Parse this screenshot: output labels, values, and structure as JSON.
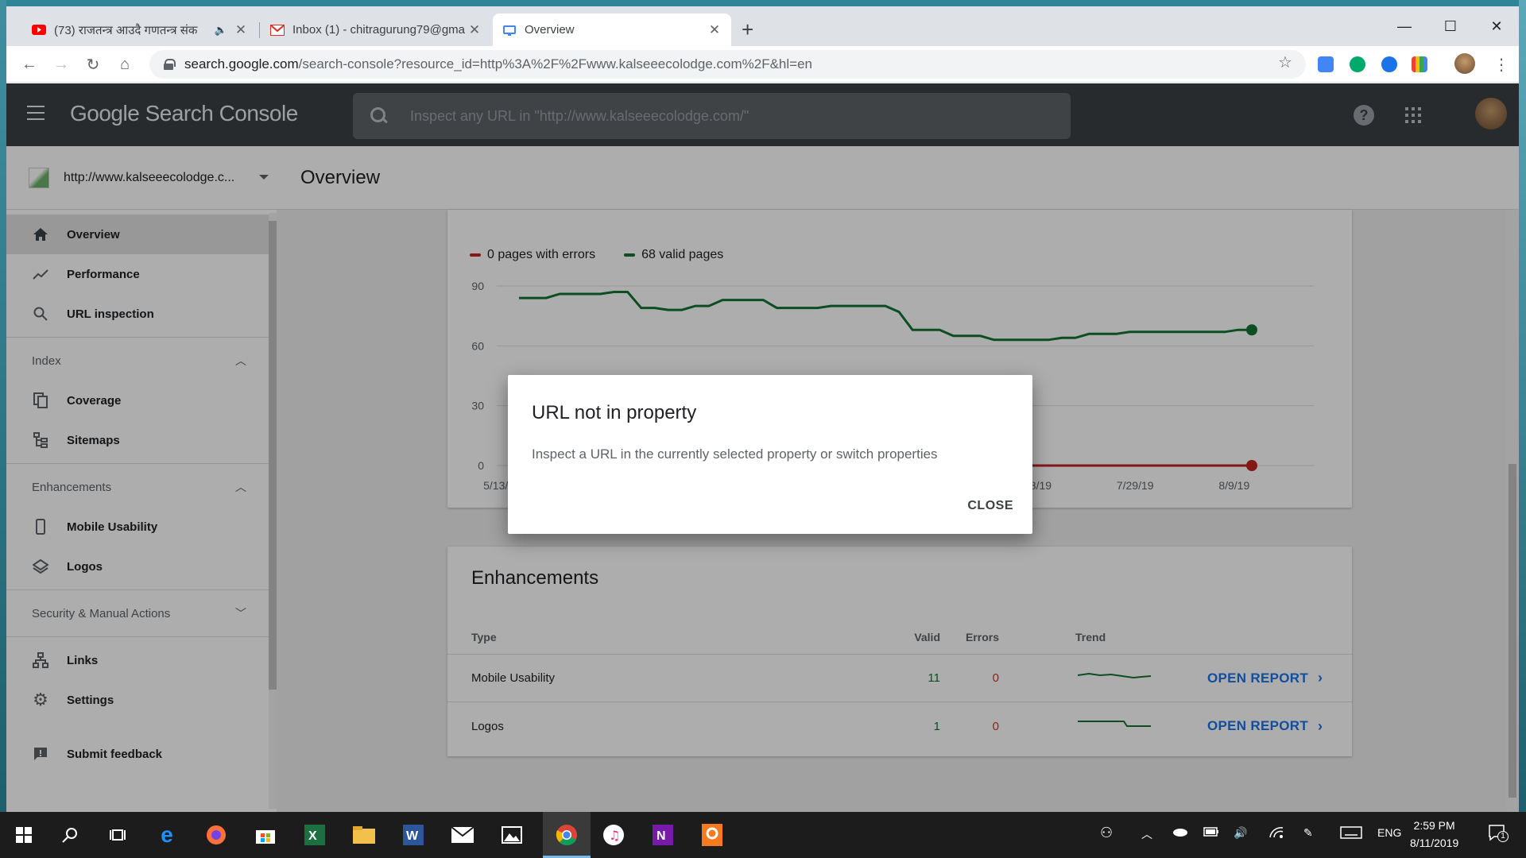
{
  "browser": {
    "tabs": [
      {
        "title": "(73) राजतन्त्र आउदै गणतन्त्र संक",
        "icon": "youtube-icon",
        "muted": true
      },
      {
        "title": "Inbox (1) - chitragurung79@gma",
        "icon": "gmail-icon"
      },
      {
        "title": "Overview",
        "icon": "search-console-icon",
        "active": true
      }
    ],
    "url_host": "search.google.com",
    "url_path": "/search-console?resource_id=http%3A%2F%2Fwww.kalseeecolodge.com%2F&hl=en"
  },
  "app": {
    "brand": "Google Search Console",
    "search_placeholder": "Inspect any URL in \"http://www.kalseeecolodge.com/\"",
    "property": "http://www.kalseeecolodge.c...",
    "page_title": "Overview"
  },
  "sidebar": {
    "top_items": [
      {
        "label": "Overview",
        "icon": "home-icon"
      },
      {
        "label": "Performance",
        "icon": "trend-icon"
      },
      {
        "label": "URL inspection",
        "icon": "search-icon"
      }
    ],
    "index_header": "Index",
    "index_items": [
      {
        "label": "Coverage",
        "icon": "copy-icon"
      },
      {
        "label": "Sitemaps",
        "icon": "sitemap-icon"
      }
    ],
    "enh_header": "Enhancements",
    "enh_items": [
      {
        "label": "Mobile Usability",
        "icon": "phone-icon"
      },
      {
        "label": "Logos",
        "icon": "layers-icon"
      }
    ],
    "security_header": "Security & Manual Actions",
    "bottom_items": [
      {
        "label": "Links",
        "icon": "links-icon"
      },
      {
        "label": "Settings",
        "icon": "gear-icon"
      }
    ],
    "feedback": "Submit feedback"
  },
  "coverage": {
    "legend_errors": "0 pages with errors",
    "legend_valid": "68 valid pages",
    "colors": {
      "errors": "#c5221f",
      "valid": "#137333"
    }
  },
  "chart_data": {
    "type": "line",
    "y_ticks": [
      "90",
      "60",
      "30",
      "0"
    ],
    "x_ticks": [
      "5/13/19",
      "7/18/19",
      "7/29/19",
      "8/9/19"
    ],
    "ylim": [
      0,
      90
    ],
    "series": [
      {
        "name": "68 valid pages",
        "values": [
          84,
          84,
          84,
          86,
          86,
          86,
          86,
          87,
          87,
          79,
          79,
          78,
          78,
          80,
          80,
          83,
          83,
          83,
          83,
          79,
          79,
          79,
          79,
          80,
          80,
          80,
          80,
          80,
          77,
          68,
          68,
          68,
          65,
          65,
          65,
          63,
          63,
          63,
          63,
          63,
          64,
          64,
          66,
          66,
          66,
          67,
          67,
          67,
          67,
          67,
          67,
          67,
          67,
          68,
          68
        ]
      },
      {
        "name": "0 pages with errors",
        "values": [
          0,
          0,
          0,
          0,
          0,
          0,
          0,
          0,
          0,
          0,
          0,
          0,
          0,
          0,
          0,
          0,
          0,
          0,
          0,
          0,
          0,
          0,
          0,
          0,
          0,
          0,
          0,
          0,
          0,
          0,
          0,
          0,
          0,
          0,
          0,
          0,
          0,
          0,
          0,
          0,
          0,
          0,
          0,
          0,
          0,
          0,
          0,
          0,
          0,
          0,
          0,
          0,
          0,
          0,
          0
        ]
      }
    ]
  },
  "enhancements": {
    "title": "Enhancements",
    "headers": {
      "type": "Type",
      "valid": "Valid",
      "errors": "Errors",
      "trend": "Trend"
    },
    "rows": [
      {
        "type": "Mobile Usability",
        "valid": "11",
        "errors": "0",
        "action": "OPEN REPORT"
      },
      {
        "type": "Logos",
        "valid": "1",
        "errors": "0",
        "action": "OPEN REPORT"
      }
    ]
  },
  "dialog": {
    "title": "URL not in property",
    "body": "Inspect a URL in the currently selected property or switch properties",
    "close": "CLOSE"
  },
  "taskbar": {
    "lang": "ENG",
    "time": "2:59 PM",
    "date": "8/11/2019",
    "notif_count": "1"
  }
}
